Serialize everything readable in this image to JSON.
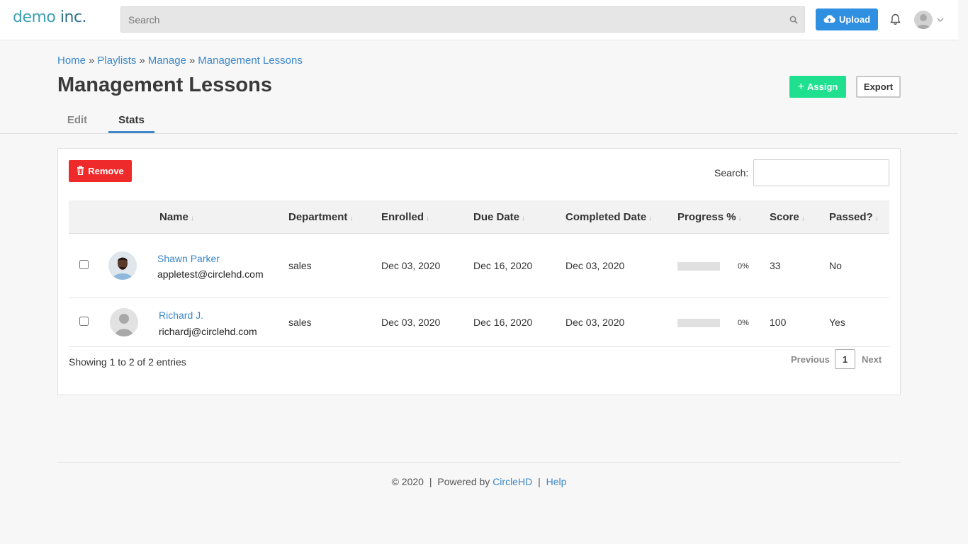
{
  "header": {
    "logo_word1": "demo",
    "logo_word2": "inc.",
    "search_placeholder": "Search",
    "upload_label": "Upload",
    "icons": [
      "search-icon",
      "cloud-upload-icon",
      "bell-icon",
      "user-avatar",
      "chevron-down-icon"
    ]
  },
  "breadcrumb": {
    "items": [
      "Home",
      "Playlists",
      "Manage",
      "Management Lessons"
    ],
    "separator": "»"
  },
  "page": {
    "title": "Management Lessons",
    "assign_label": "Assign",
    "assign_icon_text": "+",
    "export_label": "Export"
  },
  "tabs": [
    {
      "label": "Edit",
      "active": false
    },
    {
      "label": "Stats",
      "active": true
    }
  ],
  "toolbar": {
    "remove_label": "Remove",
    "search_label": "Search:",
    "search_value": ""
  },
  "table": {
    "columns": [
      "Name",
      "Department",
      "Enrolled",
      "Due Date",
      "Completed Date",
      "Progress %",
      "Score",
      "Passed?"
    ],
    "sort_glyph": "↓",
    "rows": [
      {
        "name": "Shawn Parker",
        "email": "appletest@circlehd.com",
        "department": "sales",
        "enrolled": "Dec 03, 2020",
        "due_date": "Dec 16, 2020",
        "completed_date": "Dec 03, 2020",
        "progress": 0,
        "progress_label": "0%",
        "score": "33",
        "passed": "No",
        "avatar": "photo"
      },
      {
        "name": "Richard J.",
        "email": "richardj@circlehd.com",
        "department": "sales",
        "enrolled": "Dec 03, 2020",
        "due_date": "Dec 16, 2020",
        "completed_date": "Dec 03, 2020",
        "progress": 0,
        "progress_label": "0%",
        "score": "100",
        "passed": "Yes",
        "avatar": "placeholder"
      }
    ],
    "info": "Showing 1 to 2 of 2 entries",
    "pagination": {
      "previous": "Previous",
      "current": "1",
      "next": "Next"
    }
  },
  "footer": {
    "copyright": "© 2020",
    "powered_by": "Powered by",
    "brand": "CircleHD",
    "help": "Help",
    "separator": "|"
  },
  "colors": {
    "primary": "#3b87c9",
    "upload": "#2f8fe0",
    "assign": "#1ee08e",
    "remove": "#ee2a2a"
  }
}
